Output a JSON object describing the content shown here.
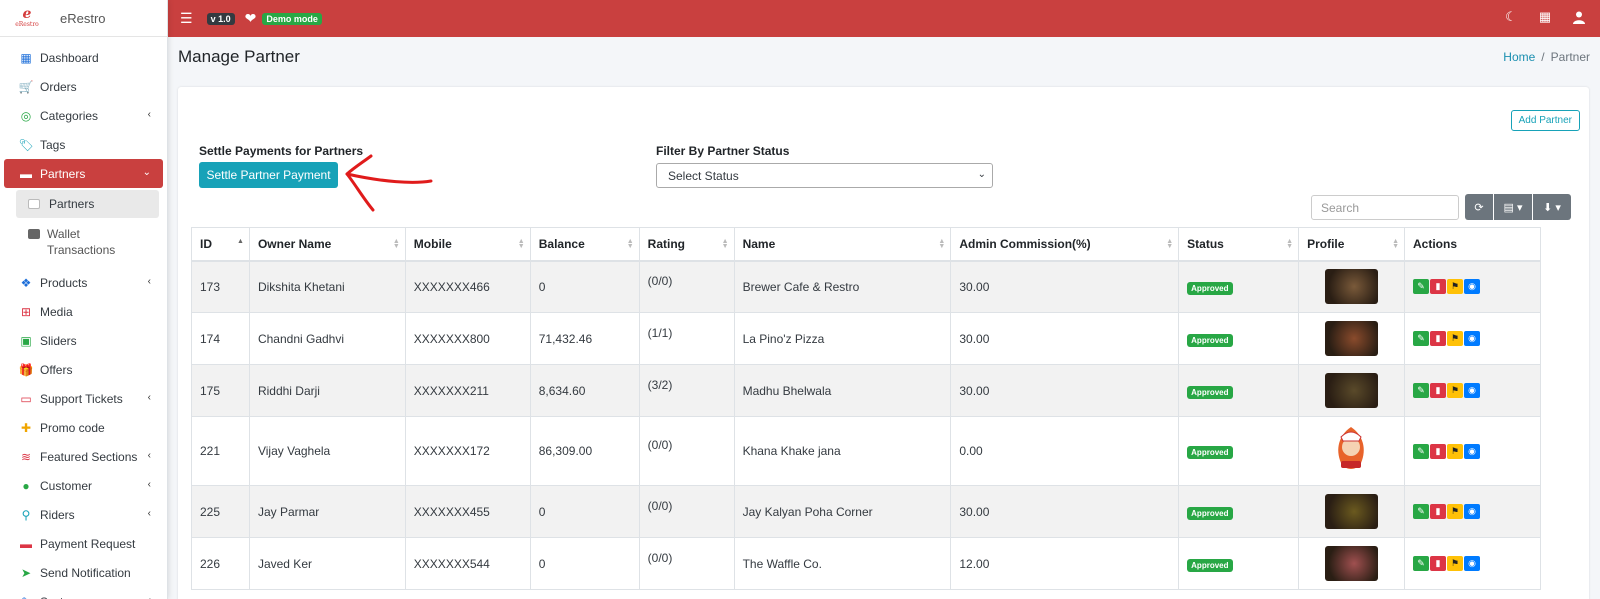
{
  "brand": {
    "logo_letter": "e",
    "logo_text": "eRestro",
    "name": "eRestro"
  },
  "topbar": {
    "version": "v 1.0",
    "demo_label": "Demo mode"
  },
  "sidebar": {
    "items": [
      {
        "label": "Dashboard",
        "icon": "dashboard-icon",
        "chevron": false
      },
      {
        "label": "Orders",
        "icon": "cart-icon",
        "chevron": false
      },
      {
        "label": "Categories",
        "icon": "target-icon",
        "chevron": true
      },
      {
        "label": "Tags",
        "icon": "tag-icon",
        "chevron": false
      },
      {
        "label": "Partners",
        "icon": "store-icon",
        "chevron": true,
        "active": true
      },
      {
        "label": "Products",
        "icon": "cubes-icon",
        "chevron": true
      },
      {
        "label": "Media",
        "icon": "media-icon",
        "chevron": false
      },
      {
        "label": "Sliders",
        "icon": "image-icon",
        "chevron": false
      },
      {
        "label": "Offers",
        "icon": "gift-icon",
        "chevron": false
      },
      {
        "label": "Support Tickets",
        "icon": "ticket-icon",
        "chevron": true
      },
      {
        "label": "Promo code",
        "icon": "puzzle-icon",
        "chevron": false
      },
      {
        "label": "Featured Sections",
        "icon": "layers-icon",
        "chevron": true
      },
      {
        "label": "Customer",
        "icon": "user-icon",
        "chevron": true
      },
      {
        "label": "Riders",
        "icon": "bike-icon",
        "chevron": true
      },
      {
        "label": "Payment Request",
        "icon": "money-icon",
        "chevron": false
      },
      {
        "label": "Send Notification",
        "icon": "send-icon",
        "chevron": false
      },
      {
        "label": "System",
        "icon": "wrench-icon",
        "chevron": true
      }
    ],
    "sub_partners": "Partners",
    "sub_wallet": "Wallet Transactions"
  },
  "page": {
    "title": "Manage Partner",
    "breadcrumb_home": "Home",
    "breadcrumb_sep": "/",
    "breadcrumb_current": "Partner"
  },
  "card": {
    "add_button": "Add Partner",
    "settle_label": "Settle Payments for Partners",
    "settle_button": "Settle Partner Payment",
    "filter_label": "Filter By Partner Status",
    "filter_value": "Select Status",
    "search_placeholder": "Search"
  },
  "table": {
    "columns": [
      "ID",
      "Owner Name",
      "Mobile",
      "Balance",
      "Rating",
      "Name",
      "Admin Commission(%)",
      "Status",
      "Profile",
      "Actions"
    ],
    "rows": [
      {
        "id": "173",
        "owner": "Dikshita Khetani",
        "mobile": "XXXXXXX466",
        "balance": "0",
        "rating": "(0/0)",
        "name": "Brewer Cafe & Restro",
        "commission": "30.00",
        "status": "Approved",
        "thumb": "#7a5a3a"
      },
      {
        "id": "174",
        "owner": "Chandni Gadhvi",
        "mobile": "XXXXXXX800",
        "balance": "71,432.46",
        "rating": "(1/1)",
        "name": "La Pino'z Pizza",
        "commission": "30.00",
        "status": "Approved",
        "thumb": "#8a4b2c"
      },
      {
        "id": "175",
        "owner": "Riddhi Darji",
        "mobile": "XXXXXXX211",
        "balance": "8,634.60",
        "rating": "(3/2)",
        "name": "Madhu Bhelwala",
        "commission": "30.00",
        "status": "Approved",
        "thumb": "#5a4a2a"
      },
      {
        "id": "221",
        "owner": "Vijay Vaghela",
        "mobile": "XXXXXXX172",
        "balance": "86,309.00",
        "rating": "(0/0)",
        "name": "Khana Khake jana",
        "commission": "0.00",
        "status": "Approved",
        "thumb": "chef"
      },
      {
        "id": "225",
        "owner": "Jay Parmar",
        "mobile": "XXXXXXX455",
        "balance": "0",
        "rating": "(0/0)",
        "name": "Jay Kalyan Poha Corner",
        "commission": "30.00",
        "status": "Approved",
        "thumb": "#6b5a1f"
      },
      {
        "id": "226",
        "owner": "Javed Ker",
        "mobile": "XXXXXXX544",
        "balance": "0",
        "rating": "(0/0)",
        "name": "The Waffle Co.",
        "commission": "12.00",
        "status": "Approved",
        "thumb": "#a05050"
      }
    ]
  },
  "colors": {
    "brand_red": "#c9403f",
    "info": "#17a2b8",
    "success": "#28a745",
    "danger": "#dc3545",
    "warning": "#ffc107",
    "primary": "#007bff"
  }
}
